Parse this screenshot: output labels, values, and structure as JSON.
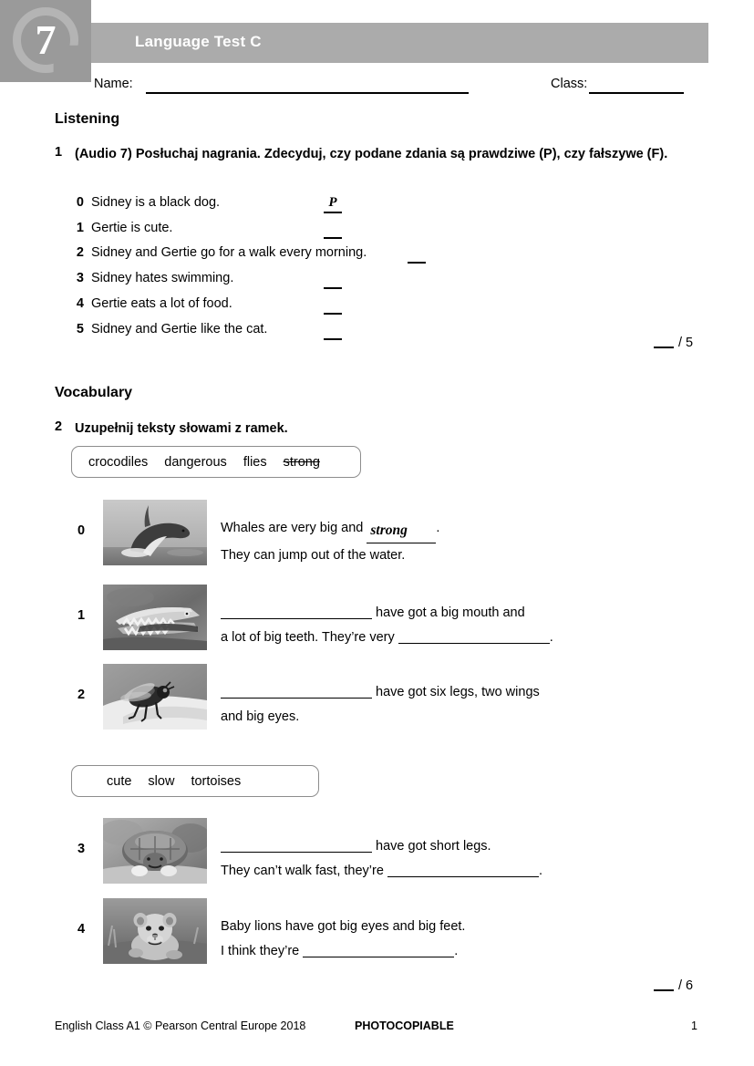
{
  "header": {
    "unit_number": "7",
    "title": "Language Test C",
    "name_label": "Name:",
    "name_value": "",
    "class_label": "Class:",
    "class_value": ""
  },
  "listening": {
    "heading": "Listening",
    "task_number": "1",
    "instruction": "(Audio 7) Posłuchaj nagrania. Zdecyduj, czy podane zdania są prawdziwe (P), czy fałszywe (F).",
    "statements": [
      {
        "idx": "0",
        "text": "Sidney is a black dog.",
        "answer": "P",
        "answer_given": true
      },
      {
        "idx": "1",
        "text": "Gertie is cute.",
        "answer": "",
        "answer_given": false
      },
      {
        "idx": "2",
        "text": "Sidney and Gertie go for a walk every morning.",
        "answer": "",
        "answer_given": false
      },
      {
        "idx": "3",
        "text": "Sidney hates swimming.",
        "answer": "",
        "answer_given": false
      },
      {
        "idx": "4",
        "text": "Gertie eats a lot of food.",
        "answer": "",
        "answer_given": false
      },
      {
        "idx": "5",
        "text": "Sidney and Gertie like the cat.",
        "answer": "",
        "answer_given": false
      }
    ],
    "score": "/ 5"
  },
  "vocabulary": {
    "heading": "Vocabulary",
    "task_number": "2",
    "instruction": "Uzupełnij teksty słowami z ramek.",
    "wordbank_1": {
      "words": [
        {
          "text": "crocodiles",
          "used": false
        },
        {
          "text": "dangerous",
          "used": false
        },
        {
          "text": "flies",
          "used": false
        },
        {
          "text": "strong",
          "used": true
        }
      ]
    },
    "wordbank_2": {
      "words": [
        {
          "text": "cute",
          "used": false
        },
        {
          "text": "slow",
          "used": false
        },
        {
          "text": "tortoises",
          "used": false
        }
      ]
    },
    "items": [
      {
        "idx": "0",
        "image": "whale-photo",
        "line1_before": "Whales are very big and",
        "line1_answer": "strong",
        "line1_after": ".",
        "line2": "They can jump out of the water."
      },
      {
        "idx": "1",
        "image": "crocodile-photo",
        "line1_before": "",
        "line1_after": " have got a big mouth and",
        "line2_before": "a lot of big teeth. They’re very ",
        "line2_after": "."
      },
      {
        "idx": "2",
        "image": "fly-photo",
        "line1_before": "",
        "line1_after": " have got six legs, two wings",
        "line2_before": "and big eyes.",
        "line2_after": ""
      },
      {
        "idx": "3",
        "image": "tortoise-photo",
        "line1_before": "",
        "line1_after": " have got short legs.",
        "line2_before": "They can’t walk fast, they’re ",
        "line2_after": "."
      },
      {
        "idx": "4",
        "image": "lion-cub-photo",
        "line1_before": "Baby lions have got big eyes and big feet.",
        "line1_after": "",
        "line2_before": "I think they’re ",
        "line2_after": "."
      }
    ],
    "score": "/ 6"
  },
  "footer": {
    "credit": "English Class A1 © Pearson Central Europe 2018",
    "photocopiable": "PHOTOCOPIABLE",
    "page": "1"
  },
  "colors": {
    "badge_bg": "#9a9a9a",
    "badge_ring": "#b4b4b4",
    "title_bar": "#ababab",
    "title_text": "#ffffff",
    "body_text": "#000000",
    "wordbank_border": "#8d8d8d"
  }
}
